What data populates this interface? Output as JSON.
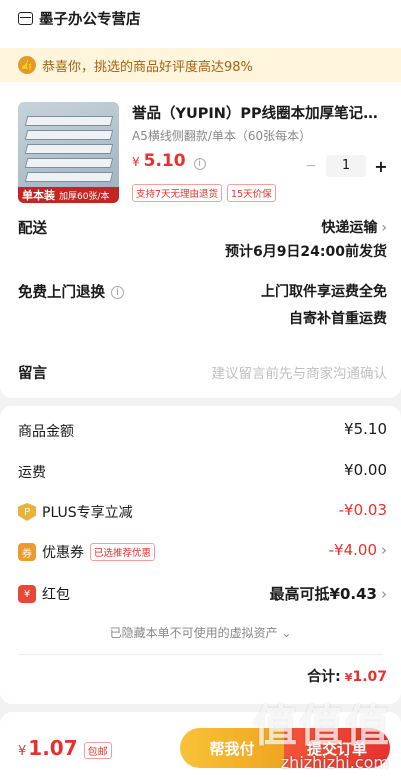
{
  "store": {
    "name": "墨子办公专营店",
    "icon": "store-icon"
  },
  "banner": {
    "text": "恭喜你，挑选的商品好评度高达98%",
    "icon": "thumb-up-icon"
  },
  "product": {
    "image_tag_main": "单本装",
    "image_tag_sub": "加厚60张/本",
    "title": "誉品（YUPIN）PP线圈本加厚笔记本...",
    "spec": "A5横线侧翻款/单本（60张每本）",
    "price_currency": "¥",
    "price_value": "5.10",
    "quantity": "1",
    "minus": "−",
    "plus": "+",
    "badges": [
      "支持7天无理由退货",
      "15天价保"
    ]
  },
  "delivery": {
    "label": "配送",
    "method": "快递运输",
    "eta": "预计6月9日24:00前发货"
  },
  "returns": {
    "label": "免费上门退换",
    "line1": "上门取件享运费全免",
    "line2": "自寄补首重运费"
  },
  "note": {
    "label": "留言",
    "placeholder": "建议留言前先与商家沟通确认"
  },
  "fees": {
    "goods_label": "商品金额",
    "goods_value": "¥5.10",
    "shipping_label": "运费",
    "shipping_value": "¥0.00",
    "plus_label": "PLUS专享立减",
    "plus_value": "-¥0.03",
    "coupon_label": "优惠券",
    "coupon_tag": "已选推荐优惠",
    "coupon_value": "-¥4.00",
    "hongbao_label": "红包",
    "hongbao_value": "最高可抵¥0.43",
    "hidden_assets": "已隐藏本单不可使用的虚拟资产 ⌄",
    "total_label": "合计:",
    "total_currency": "¥",
    "total_value": "1.07"
  },
  "footer": {
    "currency": "¥",
    "price": "1.07",
    "shipfree": "包邮",
    "help_pay": "帮我付",
    "pay": "提交订单"
  },
  "watermark": {
    "text": "值值值",
    "url": "zhizhizhi.com"
  },
  "colors": {
    "accent_red": "#e5322d",
    "accent_orange": "#f0a51f",
    "banner_bg": "#fff5dc"
  }
}
